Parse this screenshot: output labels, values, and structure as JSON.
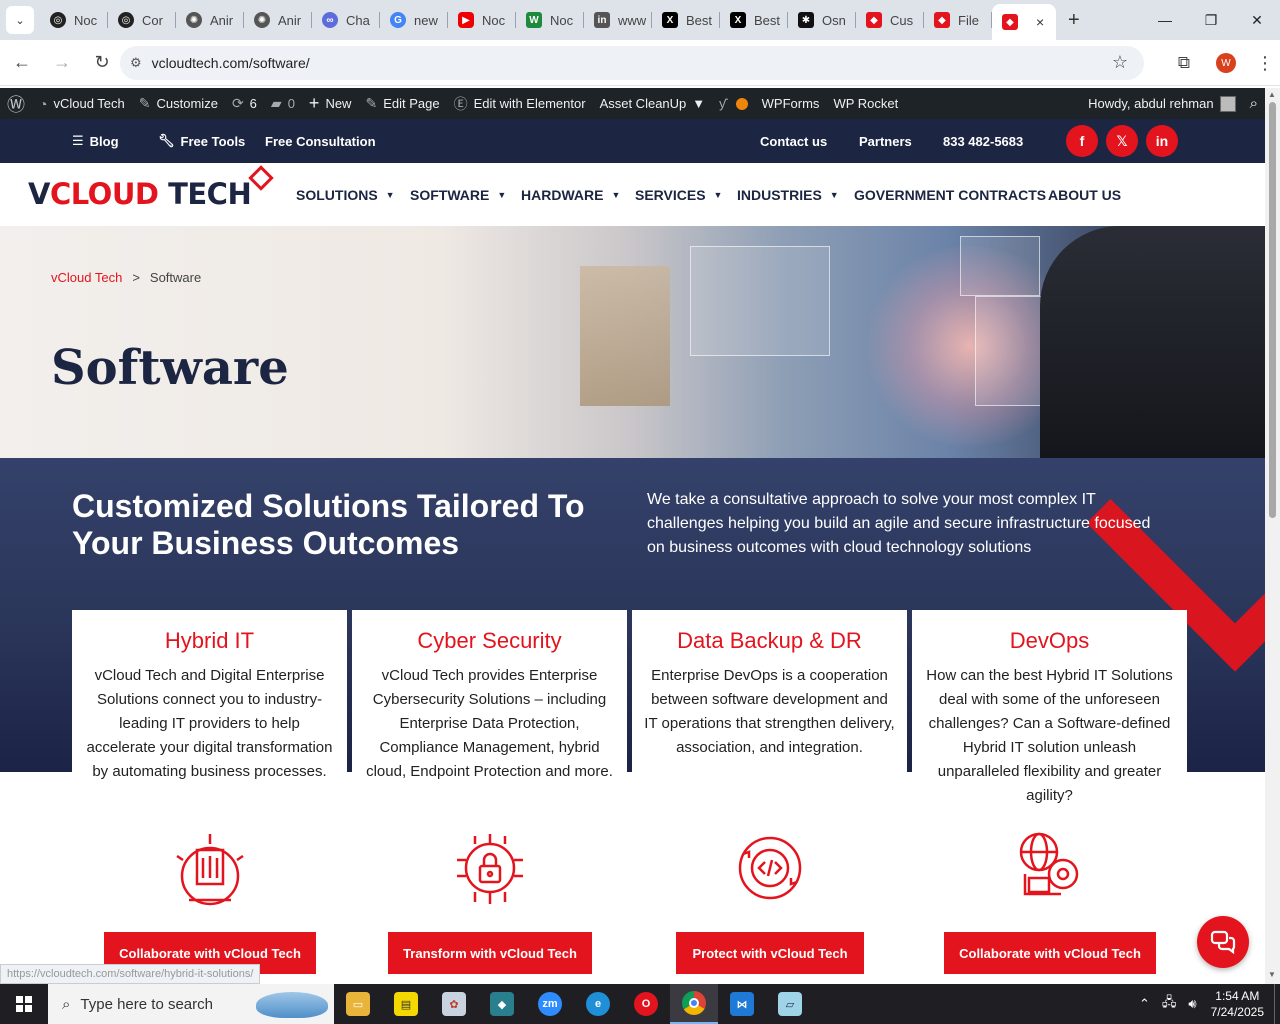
{
  "browser": {
    "tabs": [
      {
        "label": "Noc",
        "fav_color": "#222"
      },
      {
        "label": "Cor",
        "fav_color": "#222"
      },
      {
        "label": "Anir",
        "fav_color": "#555"
      },
      {
        "label": "Anir",
        "fav_color": "#555"
      },
      {
        "label": "Cha",
        "fav_color": "#5d6cdb"
      },
      {
        "label": "new",
        "fav_color": "#4285f4"
      },
      {
        "label": "Noc",
        "fav_color": "#e00"
      },
      {
        "label": "Noc",
        "fav_color": "#1e8a3c"
      },
      {
        "label": "www",
        "fav_color": "#555"
      },
      {
        "label": "Best",
        "fav_color": "#000"
      },
      {
        "label": "Best",
        "fav_color": "#000"
      },
      {
        "label": "Osn",
        "fav_color": "#111"
      },
      {
        "label": "Cus",
        "fav_color": "#e3141d"
      },
      {
        "label": "File",
        "fav_color": "#e3141d"
      }
    ],
    "active_tab_close": "×",
    "url": "vcloudtech.com/software/",
    "profile_initial": "W"
  },
  "adminbar": {
    "site_name": "vCloud Tech",
    "customize": "Customize",
    "updates_count": "6",
    "comments_count": "0",
    "new": "New",
    "edit_page": "Edit Page",
    "edit_elementor": "Edit with Elementor",
    "asset_cleanup": "Asset CleanUp",
    "wpforms": "WPForms",
    "wp_rocket": "WP Rocket",
    "howdy": "Howdy, abdul rehman"
  },
  "topbar": {
    "blog": "Blog",
    "free_tools": "Free Tools",
    "free_consultation": "Free Consultation",
    "contact": "Contact us",
    "partners": "Partners",
    "phone": "833 482-5683",
    "social": {
      "facebook": "f",
      "x": "𝕏",
      "linkedin": "in"
    }
  },
  "logo": {
    "part1": "V",
    "part2": "CLOUD",
    "part3": " TECH"
  },
  "nav": {
    "solutions": "SOLUTIONS",
    "software": "SOFTWARE",
    "hardware": "HARDWARE",
    "services": "SERVICES",
    "industries": "INDUSTRIES",
    "gov": "GOVERNMENT CONTRACTS",
    "about": "ABOUT US"
  },
  "hero": {
    "breadcrumb_home": "vCloud Tech",
    "breadcrumb_sep": ">",
    "breadcrumb_current": "Software",
    "title": "Software"
  },
  "band": {
    "title": "Customized Solutions Tailored To Your Business Outcomes",
    "text": "We take a consultative approach to solve your most complex IT challenges helping you build an agile and secure infrastructure focused on business outcomes with cloud technology solutions"
  },
  "cards": [
    {
      "title": "Hybrid IT",
      "body": "vCloud Tech and Digital Enterprise Solutions connect you to industry-leading IT providers to help accelerate your digital transformation by automating business processes.",
      "button": "Collaborate with vCloud Tech"
    },
    {
      "title": "Cyber Security",
      "body": "vCloud Tech provides Enterprise Cybersecurity Solutions – including Enterprise Data Protection, Compliance Management, hybrid cloud, Endpoint Protection and more.",
      "button": "Transform with vCloud Tech"
    },
    {
      "title": "Data Backup & DR",
      "body": "Enterprise DevOps is a cooperation between software development and IT operations that strengthen delivery, association, and integration.",
      "button": "Protect with vCloud Tech"
    },
    {
      "title": "DevOps",
      "body": "How can the best Hybrid IT Solutions deal with some of the unforeseen challenges? Can a Software-defined Hybrid IT solution unleash unparalleled flexibility and greater agility?",
      "button": "Collaborate with vCloud Tech"
    }
  ],
  "status_url": "https://vcloudtech.com/software/hybrid-it-solutions/",
  "taskbar": {
    "search_placeholder": "Type here to search",
    "time": "1:54 AM",
    "date": "7/24/2025"
  },
  "colors": {
    "brand_red": "#e3141d",
    "brand_navy": "#1c2541",
    "admin_bar": "#1d2327"
  }
}
